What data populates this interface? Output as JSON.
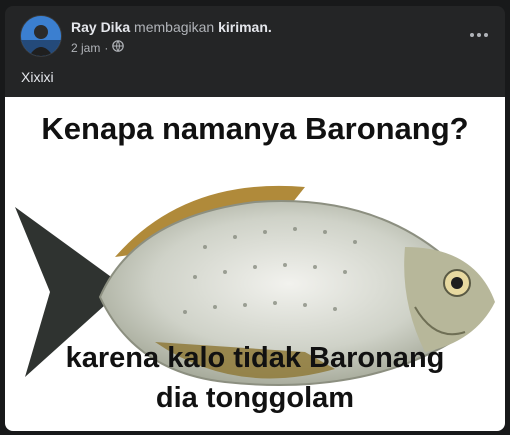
{
  "post": {
    "author": "Ray Dika",
    "action": "membagikan",
    "object": "kiriman.",
    "time": "2 jam",
    "privacy_icon": "globe-icon",
    "more_icon": "more-options-icon",
    "caption": "Xixixi"
  },
  "image": {
    "line1": "Kenapa namanya Baronang?",
    "line2": "karena kalo tidak Baronang",
    "line3": "dia tonggolam"
  },
  "colors": {
    "background": "#18191a",
    "card": "#242526",
    "primary_text": "#e4e6eb",
    "secondary_text": "#b0b3b8"
  }
}
